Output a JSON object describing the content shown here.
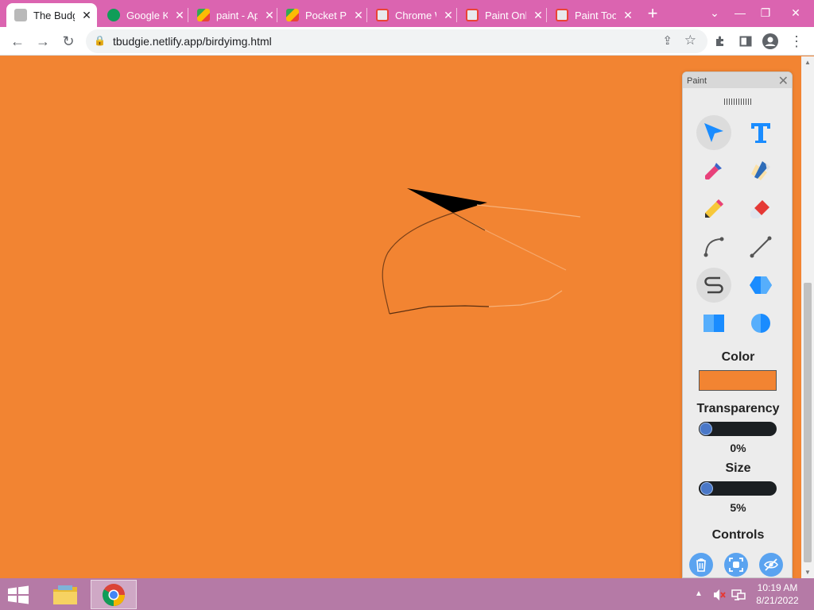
{
  "tabs": [
    {
      "title": "The Budgie",
      "icon": "budgie-favicon",
      "active": true
    },
    {
      "title": "Google Keep",
      "icon": "google-favicon",
      "active": false
    },
    {
      "title": "paint - Apps",
      "icon": "play-store-favicon",
      "active": false
    },
    {
      "title": "Pocket Paint",
      "icon": "play-store-favicon",
      "active": false
    },
    {
      "title": "Chrome Web Store",
      "icon": "chrome-webstore-favicon",
      "active": false
    },
    {
      "title": "Paint Online",
      "icon": "chrome-webstore-favicon",
      "active": false
    },
    {
      "title": "Paint Tool",
      "icon": "chrome-webstore-favicon",
      "active": false
    }
  ],
  "toolbar": {
    "url": "tbudgie.netlify.app/birdyimg.html"
  },
  "paint": {
    "title": "Paint",
    "tools": [
      {
        "name": "select-tool",
        "icon": "cursor-arrow-icon",
        "selected": true
      },
      {
        "name": "text-tool",
        "icon": "text-t-icon",
        "selected": false
      },
      {
        "name": "dropper-tool",
        "icon": "eyedropper-icon",
        "selected": false
      },
      {
        "name": "fill-tool",
        "icon": "paint-bucket-icon",
        "selected": false
      },
      {
        "name": "pencil-tool",
        "icon": "pencil-icon",
        "selected": false
      },
      {
        "name": "eraser-tool",
        "icon": "eraser-icon",
        "selected": false
      },
      {
        "name": "curve-tool",
        "icon": "curve-icon",
        "selected": false
      },
      {
        "name": "line-tool",
        "icon": "line-icon",
        "selected": false
      },
      {
        "name": "freeform-tool",
        "icon": "squiggle-icon",
        "selected": true
      },
      {
        "name": "polygon-tool",
        "icon": "hexagon-icon",
        "selected": false
      },
      {
        "name": "rectangle-tool",
        "icon": "square-icon",
        "selected": false
      },
      {
        "name": "ellipse-tool",
        "icon": "circle-icon",
        "selected": false
      }
    ],
    "color_label": "Color",
    "color_value": "#f28432",
    "transparency_label": "Transparency",
    "transparency_value": "0%",
    "transparency_level": 0,
    "size_label": "Size",
    "size_value": "5%",
    "size_level": 5,
    "controls_label": "Controls",
    "controls": [
      {
        "name": "trash-icon"
      },
      {
        "name": "screenshot-icon"
      },
      {
        "name": "eye-hidden-icon"
      }
    ]
  },
  "taskbar": {
    "apps": [
      {
        "name": "file-explorer-icon"
      },
      {
        "name": "chrome-icon",
        "active": true
      }
    ],
    "time": "10:19 AM",
    "date": "8/21/2022"
  },
  "colors": {
    "tab_strip": "#db64b0",
    "canvas": "#f28432",
    "accent_blue": "#1a8cff",
    "taskbar": "#b57aa6"
  }
}
